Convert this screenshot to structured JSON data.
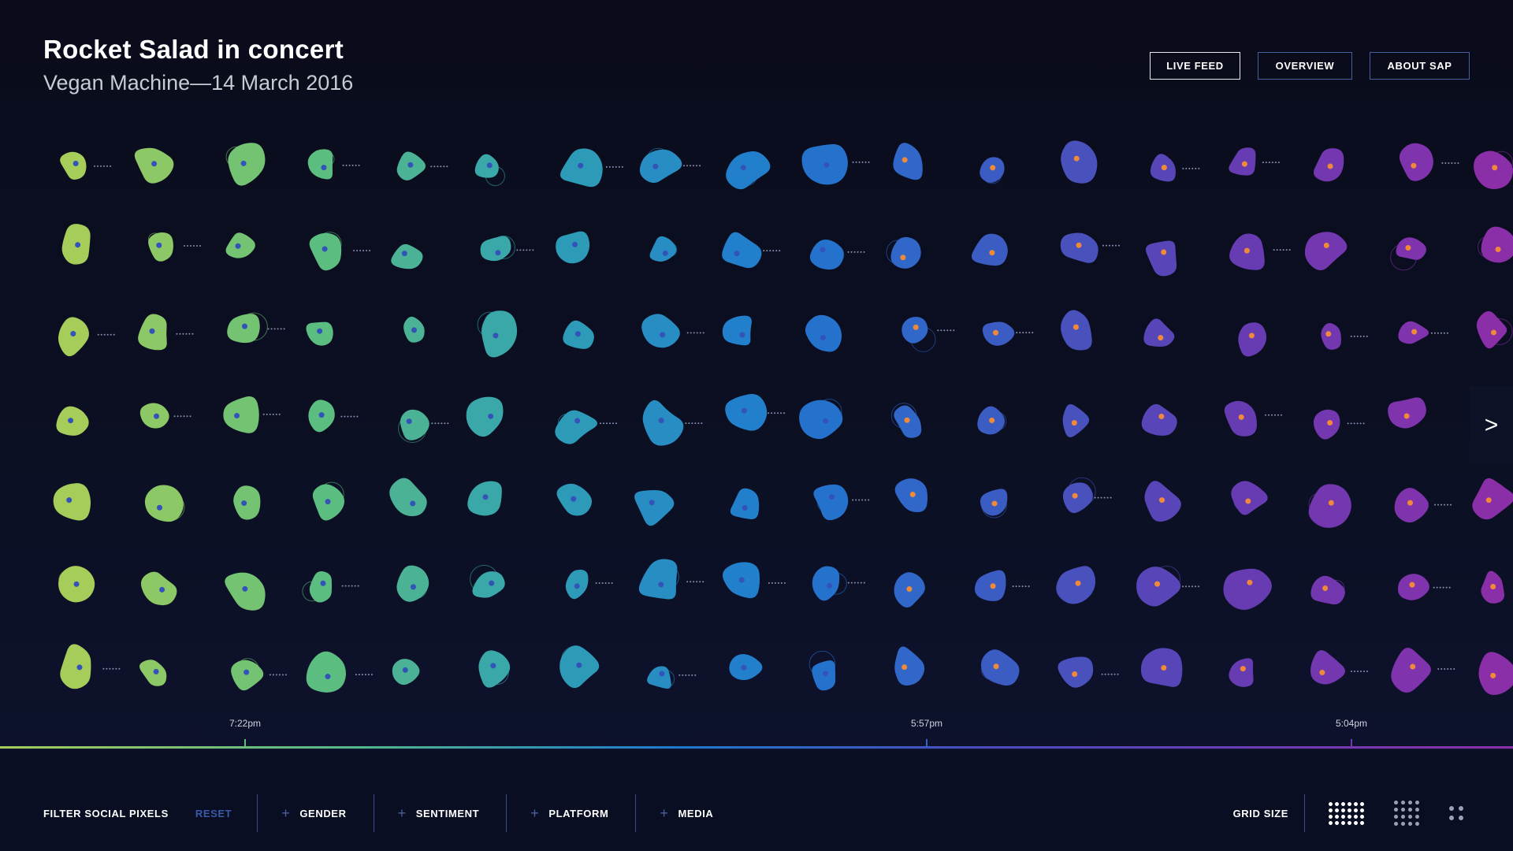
{
  "header": {
    "title": "Rocket Salad in concert",
    "subtitle": "Vegan Machine—14 March 2016"
  },
  "nav": {
    "live_feed": "LIVE FEED",
    "overview": "OVERVIEW",
    "about": "ABOUT SAP"
  },
  "timeline": {
    "markers": [
      "7:22pm",
      "5:57pm",
      "5:04pm"
    ]
  },
  "next_label": ">",
  "filters": {
    "label": "FILTER SOCIAL PIXELS",
    "reset": "RESET",
    "items": [
      "GENDER",
      "SENTIMENT",
      "PLATFORM",
      "MEDIA"
    ]
  },
  "grid_size": {
    "label": "GRID SIZE"
  },
  "colors": {
    "gradient": [
      "#a6cd5a",
      "#5fbf7e",
      "#2f9fb5",
      "#1f78d0",
      "#3f58c0",
      "#6a3ab2",
      "#8a2fa8"
    ],
    "dot_primary": "#3353b8",
    "dot_secondary": "#f08a3a"
  },
  "icons": {
    "next": "chevron-right-icon",
    "plus": "plus-icon",
    "grid": "grid-dots-icon"
  }
}
